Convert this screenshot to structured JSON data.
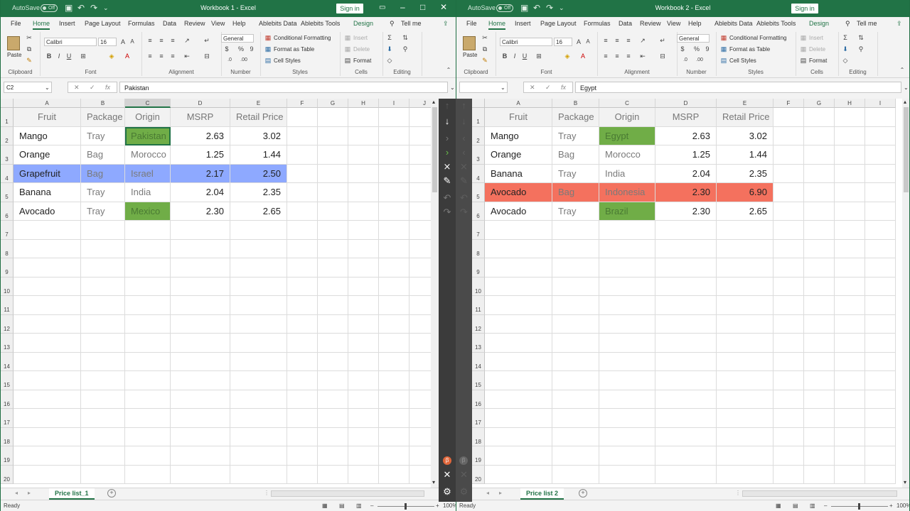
{
  "left": {
    "title": "Workbook 1 - Excel",
    "autosave_label": "AutoSave",
    "autosave_state": "Off",
    "sign_in": "Sign in",
    "tabs": [
      "File",
      "Home",
      "Insert",
      "Page Layout",
      "Formulas",
      "Data",
      "Review",
      "View",
      "Help",
      "Ablebits Data",
      "Ablebits Tools",
      "Design"
    ],
    "tell_me": "Tell me",
    "font_name": "Calibri",
    "font_size": "16",
    "number_format": "General",
    "ribbon_groups": [
      "Clipboard",
      "Font",
      "Alignment",
      "Number",
      "Styles",
      "Cells",
      "Editing"
    ],
    "paste": "Paste",
    "cond_format": "Conditional Formatting",
    "format_table": "Format as Table",
    "cell_styles": "Cell Styles",
    "insert": "Insert",
    "delete": "Delete",
    "format": "Format",
    "name_box": "C2",
    "formula": "Pakistan",
    "columns": [
      "A",
      "B",
      "C",
      "D",
      "E",
      "F",
      "G",
      "H",
      "I",
      "J"
    ],
    "rows": [
      "1",
      "2",
      "3",
      "4",
      "5",
      "6",
      "7",
      "8",
      "9",
      "10",
      "11",
      "12",
      "13",
      "14",
      "15",
      "16",
      "17",
      "18",
      "19",
      "20"
    ],
    "headers": [
      "Fruit",
      "Package",
      "Origin",
      "MSRP",
      "Retail Price"
    ],
    "data": [
      [
        "Mango",
        "Tray",
        "Pakistan",
        "2.63",
        "3.02"
      ],
      [
        "Orange",
        "Bag",
        "Morocco",
        "1.25",
        "1.44"
      ],
      [
        "Grapefruit",
        "Bag",
        "Israel",
        "2.17",
        "2.50"
      ],
      [
        "Banana",
        "Tray",
        "India",
        "2.04",
        "2.35"
      ],
      [
        "Avocado",
        "Tray",
        "Mexico",
        "2.30",
        "2.65"
      ]
    ],
    "sheet_tab": "Price list_1",
    "status": "Ready",
    "zoom": "100%"
  },
  "right": {
    "title": "Workbook 2 - Excel",
    "autosave_label": "AutoSave",
    "autosave_state": "Off",
    "sign_in": "Sign in",
    "tabs": [
      "File",
      "Home",
      "Insert",
      "Page Layout",
      "Formulas",
      "Data",
      "Review",
      "View",
      "Help",
      "Ablebits Data",
      "Ablebits Tools",
      "Design"
    ],
    "tell_me": "Tell me",
    "font_name": "Calibri",
    "font_size": "16",
    "number_format": "General",
    "ribbon_groups": [
      "Clipboard",
      "Font",
      "Alignment",
      "Number",
      "Styles",
      "Cells",
      "Editing"
    ],
    "paste": "Paste",
    "cond_format": "Conditional Formatting",
    "format_table": "Format as Table",
    "cell_styles": "Cell Styles",
    "insert": "Insert",
    "delete": "Delete",
    "format": "Format",
    "name_box": "",
    "formula": "Egypt",
    "columns": [
      "A",
      "B",
      "C",
      "D",
      "E",
      "F",
      "G",
      "H",
      "I"
    ],
    "rows": [
      "1",
      "2",
      "3",
      "4",
      "5",
      "6",
      "7",
      "8",
      "9",
      "10",
      "11",
      "12",
      "13",
      "14",
      "15",
      "16",
      "17",
      "18",
      "19",
      "20"
    ],
    "headers": [
      "Fruit",
      "Package",
      "Origin",
      "MSRP",
      "Retail Price"
    ],
    "data": [
      [
        "Mango",
        "Tray",
        "Egypt",
        "2.63",
        "3.02"
      ],
      [
        "Orange",
        "Bag",
        "Morocco",
        "1.25",
        "1.44"
      ],
      [
        "Banana",
        "Tray",
        "India",
        "2.04",
        "2.35"
      ],
      [
        "Avocado",
        "Bag",
        "Indonesia",
        "2.30",
        "6.90"
      ],
      [
        "Avocado",
        "Tray",
        "Brazil",
        "2.30",
        "2.65"
      ]
    ],
    "sheet_tab": "Price list 2",
    "status": "Ready",
    "zoom": "100%"
  },
  "colors": {
    "excel_green": "#217346",
    "cell_diff_green": "#70ad47",
    "row_unique_blue": "#8ea9ff",
    "row_unique_red": "#f4715e"
  },
  "compare_toolbar_icons": [
    "up-arrow-icon",
    "down-arrow-icon",
    "push-right-icon",
    "push-right-all-icon",
    "clear-icon",
    "eraser-icon",
    "undo-icon",
    "redo-icon",
    "beta-icon",
    "close-icon",
    "settings-icon"
  ]
}
